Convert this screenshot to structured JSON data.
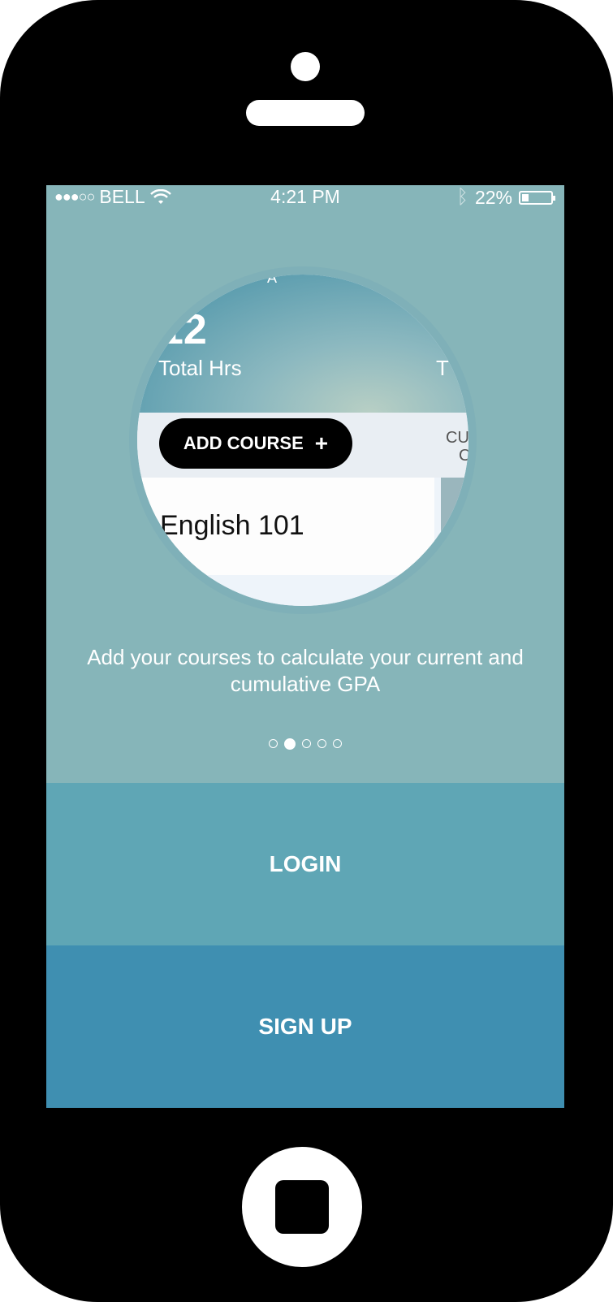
{
  "status_bar": {
    "signal": "●●●○○",
    "carrier": "BELL",
    "wifi_icon": "wifi-icon",
    "time": "4:21 PM",
    "bluetooth_icon": "bluetooth-icon",
    "battery_percent": "22%"
  },
  "preview": {
    "top_fragment": "A",
    "big_number": "12",
    "left_label": "Total Hrs",
    "right_label": "T",
    "add_course_label": "ADD COURSE",
    "add_icon": "+",
    "right_fragment_line1": "CU",
    "right_fragment_line2": "C",
    "course_name": "English 101"
  },
  "caption": "Add your courses to calculate your current and cumulative GPA",
  "pager": {
    "count": 5,
    "active_index": 1
  },
  "buttons": {
    "login": "LOGIN",
    "signup": "SIGN UP"
  },
  "colors": {
    "screen_bg": "#86b5b9",
    "login_bg": "#5fa6b5",
    "signup_bg": "#3f8fb1"
  }
}
